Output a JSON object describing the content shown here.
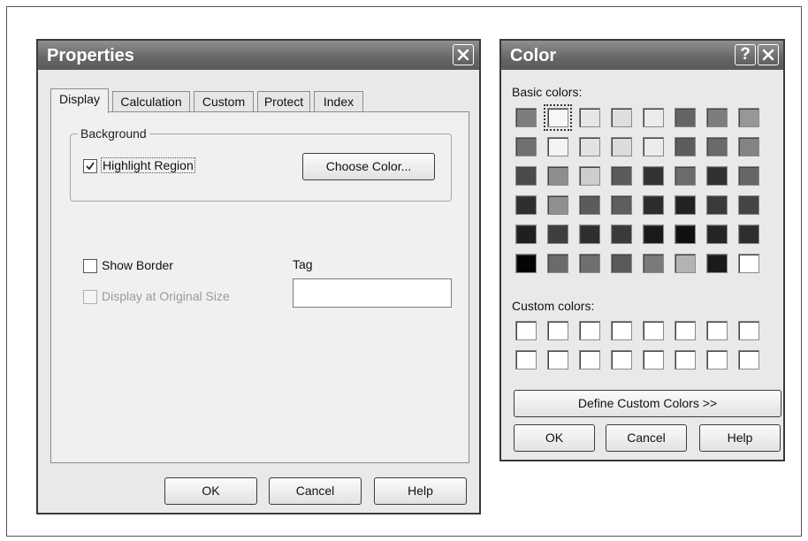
{
  "properties": {
    "title": "Properties",
    "tabs": [
      {
        "label": "Display",
        "active": true
      },
      {
        "label": "Calculation",
        "active": false
      },
      {
        "label": "Custom",
        "active": false
      },
      {
        "label": "Protect",
        "active": false
      },
      {
        "label": "Index",
        "active": false
      }
    ],
    "background_group": {
      "legend": "Background",
      "highlight_region": {
        "label": "Highlight Region",
        "checked": true
      },
      "choose_color_label": "Choose Color..."
    },
    "show_border": {
      "label": "Show Border",
      "checked": false
    },
    "display_original_size": {
      "label": "Display at Original Size",
      "checked": false,
      "disabled": true
    },
    "tag": {
      "label": "Tag",
      "value": ""
    },
    "buttons": {
      "ok": "OK",
      "cancel": "Cancel",
      "help": "Help"
    }
  },
  "color_dialog": {
    "title": "Color",
    "help_button": "?",
    "basic_colors_label": "Basic colors:",
    "basic_colors": [
      [
        "#7d7d7d",
        "#f7f7f7",
        "#e6e6e6",
        "#dedede",
        "#ebebeb",
        "#656565",
        "#7d7d7d",
        "#979797"
      ],
      [
        "#707070",
        "#f4f4f4",
        "#e2e2e2",
        "#dcdcdc",
        "#ececec",
        "#5d5d5d",
        "#6a6a6a",
        "#838383"
      ],
      [
        "#4a4a4a",
        "#8e8e8e",
        "#cdcdcd",
        "#5b5b5b",
        "#323232",
        "#6c6c6c",
        "#303030",
        "#666666"
      ],
      [
        "#2f2f2f",
        "#909090",
        "#5b5b5b",
        "#5e5e5e",
        "#2c2c2c",
        "#222222",
        "#3a3a3a",
        "#454545"
      ],
      [
        "#1f1f1f",
        "#3f3f3f",
        "#2f2f2f",
        "#3a3a3a",
        "#1a1a1a",
        "#111111",
        "#252525",
        "#2e2e2e"
      ],
      [
        "#050505",
        "#6b6b6b",
        "#6f6f6f",
        "#5a5a5a",
        "#7a7a7a",
        "#b3b3b3",
        "#1a1a1a",
        "#ffffff"
      ]
    ],
    "selected_swatch": [
      0,
      1
    ],
    "custom_colors_label": "Custom colors:",
    "custom_colors_rows": 2,
    "custom_colors_cols": 8,
    "define_custom_label": "Define Custom Colors >>",
    "buttons": {
      "ok": "OK",
      "cancel": "Cancel",
      "help": "Help"
    }
  }
}
